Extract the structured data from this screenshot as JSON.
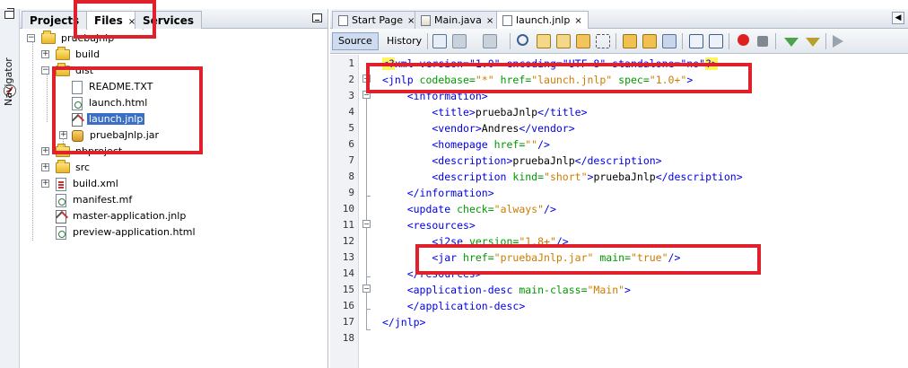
{
  "navigator": {
    "label": "Navigator"
  },
  "left_tabs": [
    {
      "label": "Projects",
      "active": false
    },
    {
      "label": "Files",
      "active": true,
      "close": "×"
    },
    {
      "label": "Services",
      "active": false
    }
  ],
  "tree": [
    {
      "label": "pruebaJnlp",
      "kind": "folder",
      "exp": "−"
    },
    {
      "label": "build",
      "kind": "folder",
      "exp": "+"
    },
    {
      "label": "dist",
      "kind": "folder",
      "exp": "−"
    },
    {
      "label": "README.TXT",
      "kind": "file"
    },
    {
      "label": "launch.html",
      "kind": "html"
    },
    {
      "label": "launch.jnlp",
      "kind": "jnlp",
      "selected": true
    },
    {
      "label": "pruebaJnlp.jar",
      "kind": "jar",
      "exp": "+"
    },
    {
      "label": "nbproject",
      "kind": "folder",
      "exp": "+"
    },
    {
      "label": "src",
      "kind": "folder",
      "exp": "+"
    },
    {
      "label": "build.xml",
      "kind": "xml",
      "exp": "+"
    },
    {
      "label": "manifest.mf",
      "kind": "html"
    },
    {
      "label": "master-application.jnlp",
      "kind": "jnlp"
    },
    {
      "label": "preview-application.html",
      "kind": "html"
    }
  ],
  "editor_tabs": [
    {
      "label": "Start Page",
      "close": "×"
    },
    {
      "label": "Main.java",
      "close": "×"
    },
    {
      "label": "launch.jnlp",
      "close": "×",
      "active": true
    }
  ],
  "toolbar": {
    "source_label": "Source",
    "history_label": "History"
  },
  "line_numbers": [
    "1",
    "2",
    "3",
    "4",
    "5",
    "6",
    "7",
    "8",
    "9",
    "10",
    "11",
    "12",
    "13",
    "14",
    "15",
    "16",
    "17",
    "18"
  ],
  "code": [
    {
      "tokens": [
        {
          "t": "<?xml version=\"1.0\" encoding=\"UTF-8\" standalone=\"no\"?>",
          "c": "tg"
        }
      ]
    },
    {
      "tokens": [
        {
          "t": "<jnlp",
          "c": "tg"
        },
        {
          "t": " codebase=",
          "c": "at"
        },
        {
          "t": "\"*\"",
          "c": "av"
        },
        {
          "t": " href=",
          "c": "at"
        },
        {
          "t": "\"launch.jnlp\"",
          "c": "av"
        },
        {
          "t": " spec=",
          "c": "at"
        },
        {
          "t": "\"1.0+\"",
          "c": "av"
        },
        {
          "t": ">",
          "c": "tg"
        }
      ]
    },
    {
      "tokens": [
        {
          "t": "    <information>",
          "c": "tg"
        }
      ]
    },
    {
      "tokens": [
        {
          "t": "        <title>",
          "c": "tg"
        },
        {
          "t": "pruebaJnlp",
          "c": "tx"
        },
        {
          "t": "</title>",
          "c": "tg"
        }
      ]
    },
    {
      "tokens": [
        {
          "t": "        <vendor>",
          "c": "tg"
        },
        {
          "t": "Andres",
          "c": "tx"
        },
        {
          "t": "</vendor>",
          "c": "tg"
        }
      ]
    },
    {
      "tokens": [
        {
          "t": "        <homepage",
          "c": "tg"
        },
        {
          "t": " href=",
          "c": "at"
        },
        {
          "t": "\"\"",
          "c": "av"
        },
        {
          "t": "/>",
          "c": "tg"
        }
      ]
    },
    {
      "tokens": [
        {
          "t": "        <description>",
          "c": "tg"
        },
        {
          "t": "pruebaJnlp",
          "c": "tx"
        },
        {
          "t": "</description>",
          "c": "tg"
        }
      ]
    },
    {
      "tokens": [
        {
          "t": "        <description",
          "c": "tg"
        },
        {
          "t": " kind=",
          "c": "at"
        },
        {
          "t": "\"short\"",
          "c": "av"
        },
        {
          "t": ">",
          "c": "tg"
        },
        {
          "t": "pruebaJnlp",
          "c": "tx"
        },
        {
          "t": "</description>",
          "c": "tg"
        }
      ]
    },
    {
      "tokens": [
        {
          "t": "    </information>",
          "c": "tg"
        }
      ]
    },
    {
      "tokens": [
        {
          "t": "    <update",
          "c": "tg"
        },
        {
          "t": " check=",
          "c": "at"
        },
        {
          "t": "\"always\"",
          "c": "av"
        },
        {
          "t": "/>",
          "c": "tg"
        }
      ]
    },
    {
      "tokens": [
        {
          "t": "    <resources>",
          "c": "tg"
        }
      ]
    },
    {
      "tokens": [
        {
          "t": "        <j2se",
          "c": "tg"
        },
        {
          "t": " version=",
          "c": "at"
        },
        {
          "t": "\"1.8+\"",
          "c": "av"
        },
        {
          "t": "/>",
          "c": "tg"
        }
      ]
    },
    {
      "tokens": [
        {
          "t": "        <jar",
          "c": "tg"
        },
        {
          "t": " href=",
          "c": "at"
        },
        {
          "t": "\"pruebaJnlp.jar\"",
          "c": "av"
        },
        {
          "t": " main=",
          "c": "at"
        },
        {
          "t": "\"true\"",
          "c": "av"
        },
        {
          "t": "/>",
          "c": "tg"
        }
      ]
    },
    {
      "tokens": [
        {
          "t": "    </resources>",
          "c": "tg"
        }
      ]
    },
    {
      "tokens": [
        {
          "t": "    <application-desc",
          "c": "tg"
        },
        {
          "t": " main-class=",
          "c": "at"
        },
        {
          "t": "\"Main\"",
          "c": "av"
        },
        {
          "t": ">",
          "c": "tg"
        }
      ]
    },
    {
      "tokens": [
        {
          "t": "    </application-desc>",
          "c": "tg"
        }
      ]
    },
    {
      "tokens": [
        {
          "t": "</jnlp>",
          "c": "tg"
        }
      ]
    },
    {
      "tokens": []
    }
  ],
  "colors": {
    "annotation": "#e0202a",
    "selection": "#3b6fc4",
    "tag": "#0000e6",
    "attr": "#009900",
    "value": "#ce7b00"
  }
}
